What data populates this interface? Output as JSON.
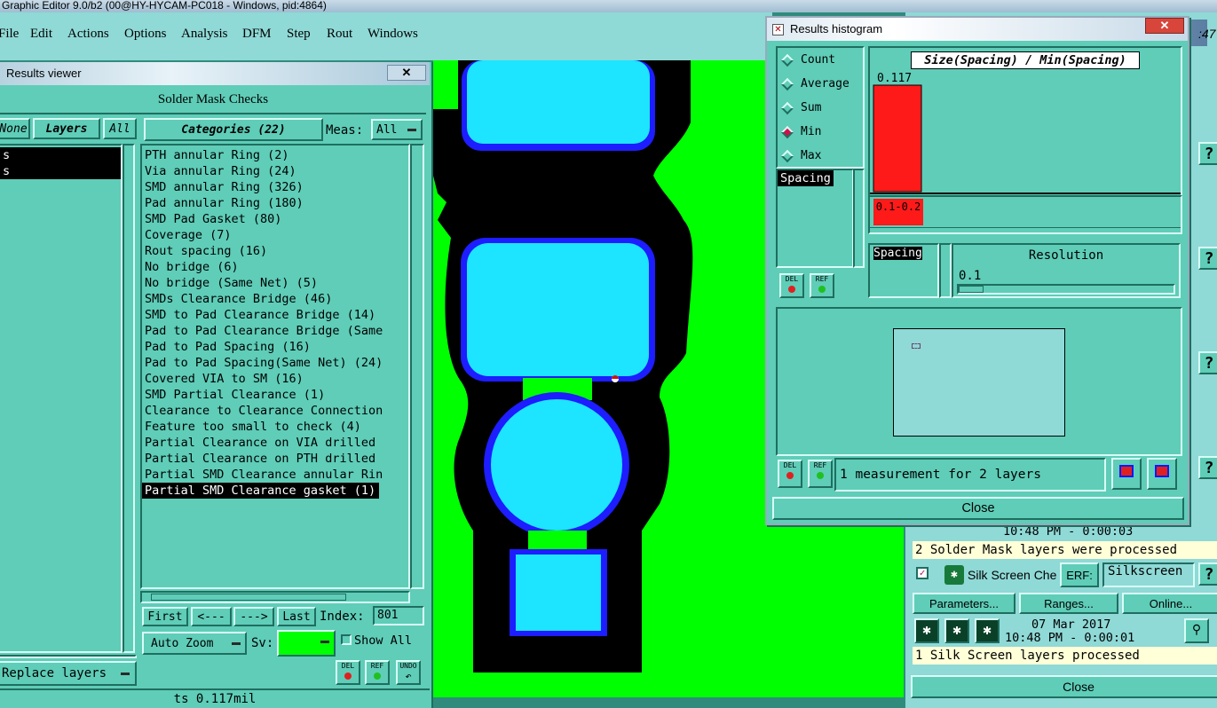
{
  "app": {
    "title": "Graphic Editor 9.0/b2 (00@HY-HYCAM-PC018 - Windows, pid:4864)",
    "clock": ":47"
  },
  "menu": [
    "File",
    "Edit",
    "Actions",
    "Options",
    "Analysis",
    "DFM",
    "Step",
    "Rout",
    "Windows"
  ],
  "viewer": {
    "title": "Results viewer",
    "heading": "Solder Mask Checks",
    "none_btn": "None",
    "layers_btn": "Layers",
    "all_btn": "All",
    "categories_btn": "Categories (22)",
    "meas_label": "Meas:",
    "meas_value": "All",
    "layer_items": [
      "s",
      "s"
    ],
    "categories": [
      "PTH annular Ring (2)",
      "Via annular Ring (24)",
      "SMD annular Ring (326)",
      "Pad annular Ring (180)",
      "SMD Pad Gasket (80)",
      "Coverage (7)",
      "Rout spacing (16)",
      "No bridge (6)",
      "No bridge (Same Net) (5)",
      "SMDs Clearance Bridge (46)",
      "SMD to Pad Clearance Bridge (14)",
      "Pad to Pad Clearance Bridge (Same",
      "Pad to Pad Spacing (16)",
      "Pad to Pad Spacing(Same Net) (24)",
      "Covered VIA to SM (16)",
      "SMD Partial Clearance (1)",
      "Clearance to Clearance Connection",
      "Feature too small to check (4)",
      "Partial Clearance on VIA drilled",
      "Partial Clearance on PTH drilled",
      "Partial SMD Clearance annular Rin",
      "Partial SMD Clearance gasket (1)"
    ],
    "first": "First",
    "prev": "<---",
    "next": "--->",
    "last": "Last",
    "index_label": "Index:",
    "index_value": "801",
    "auto_zoom": "Auto Zoom",
    "sv_label": "Sv:",
    "show_all": "Show All",
    "replace_layers": "Replace layers",
    "del": "DEL",
    "ref": "REF",
    "undo": "UNDO",
    "status": "ts 0.117mil"
  },
  "histogram": {
    "title": "Results histogram",
    "options": [
      "Count",
      "Average",
      "Sum",
      "Min",
      "Max"
    ],
    "selected": "Min",
    "chart_title": "Size(Spacing) / Min(Spacing)",
    "param_list": [
      "Spacing"
    ],
    "param_sel": "Spacing",
    "resolution_label": "Resolution",
    "resolution_value": "0.1",
    "status": "1 measurement for 2 layers",
    "close": "Close",
    "del": "DEL",
    "ref": "REF"
  },
  "chart_data": {
    "type": "bar",
    "title": "Size(Spacing) / Min(Spacing)",
    "categories": [
      "0.1-0.2"
    ],
    "values": [
      0.117
    ],
    "data_labels": [
      "0.117"
    ],
    "color": "#ff1a1a"
  },
  "right": {
    "ts1": "10:48 PM - 0:00:03",
    "msg1": "2 Solder Mask layers were processed",
    "silk": "Silk Screen Che",
    "erf": "ERF:",
    "erf_value": "Silkscreen",
    "parameters": "Parameters...",
    "ranges": "Ranges...",
    "online": "Online...",
    "date": "07 Mar 2017",
    "ts2": "10:48 PM - 0:00:01",
    "msg2": "1 Silk Screen layers processed",
    "close": "Close",
    "help": "?"
  },
  "colors": {
    "panel": "#5fcdb8",
    "canvas": "#00ff00",
    "pad": "#1de4ff",
    "pad_border": "#1515ff",
    "bar": "#ff1a1a"
  }
}
